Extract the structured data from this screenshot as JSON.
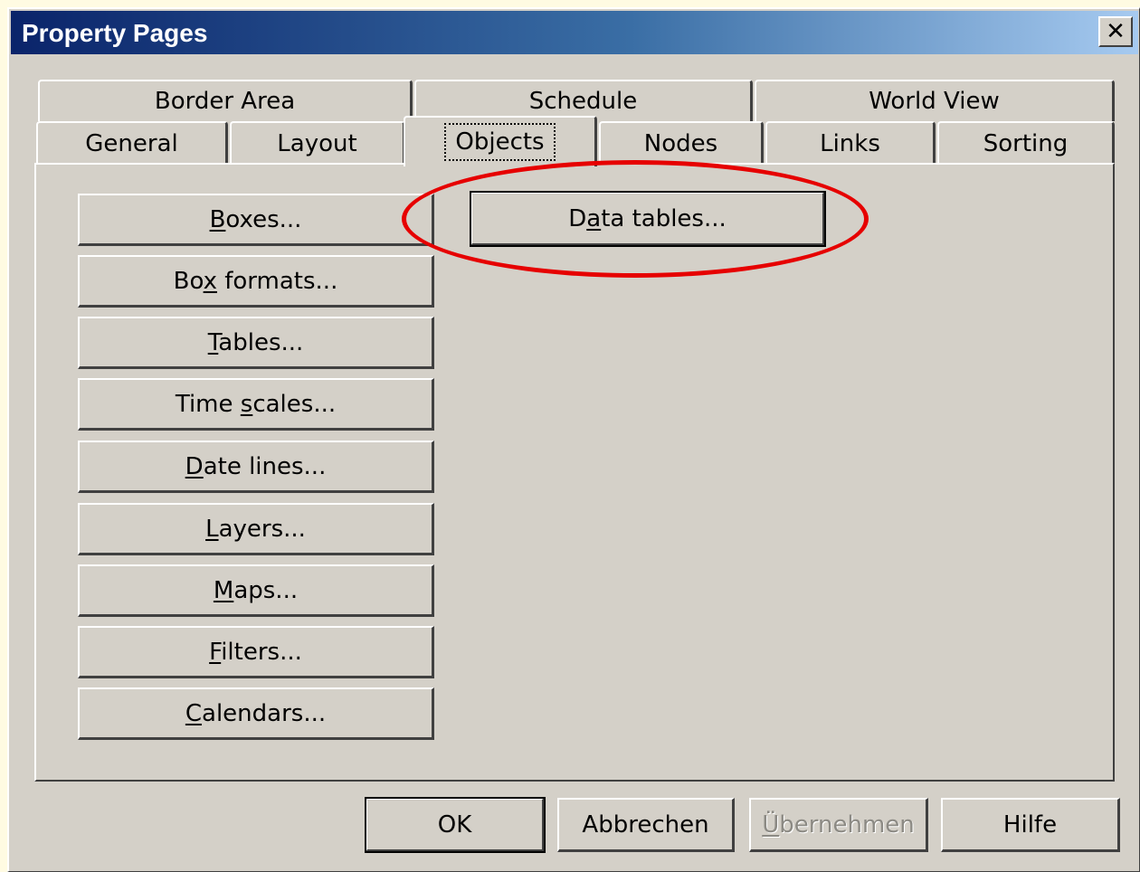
{
  "window": {
    "title": "Property Pages",
    "close_glyph": "✕"
  },
  "tabs_row1": [
    {
      "label": "Border Area"
    },
    {
      "label": "Schedule"
    },
    {
      "label": "World View"
    }
  ],
  "tabs_row2": [
    {
      "label": "General"
    },
    {
      "label": "Layout"
    },
    {
      "label": "Objects",
      "active": true
    },
    {
      "label": "Nodes"
    },
    {
      "label": "Links"
    },
    {
      "label": "Sorting"
    }
  ],
  "object_buttons": [
    {
      "pre": "",
      "key": "B",
      "post": "oxes..."
    },
    {
      "pre": "Bo",
      "key": "x",
      "post": " formats..."
    },
    {
      "pre": "",
      "key": "T",
      "post": "ables..."
    },
    {
      "pre": "Time ",
      "key": "s",
      "post": "cales..."
    },
    {
      "pre": "",
      "key": "D",
      "post": "ate lines..."
    },
    {
      "pre": "",
      "key": "L",
      "post": "ayers..."
    },
    {
      "pre": "",
      "key": "M",
      "post": "aps..."
    },
    {
      "pre": "",
      "key": "F",
      "post": "ilters..."
    },
    {
      "pre": "",
      "key": "C",
      "post": "alendars..."
    }
  ],
  "data_tables_button": {
    "pre": "D",
    "key": "a",
    "post": "ta tables..."
  },
  "footer": {
    "ok": "OK",
    "cancel": "Abbrechen",
    "apply": {
      "pre": "",
      "key": "Ü",
      "post": "bernehmen",
      "disabled": true
    },
    "help": "Hilfe"
  },
  "annotation": {
    "color": "#e60000",
    "target": "data-tables-button"
  }
}
